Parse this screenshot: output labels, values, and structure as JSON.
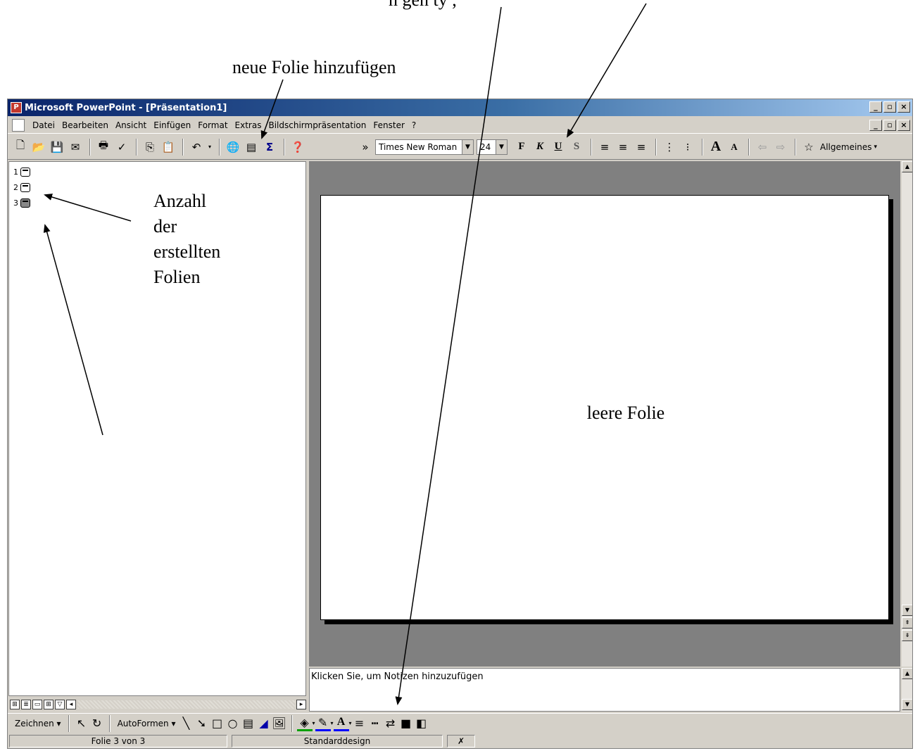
{
  "annotations": {
    "top_text": "n gen ty ,",
    "new_slide": "neue Folie hinzufügen",
    "slide_count": [
      "Anzahl",
      "der",
      "erstellten",
      "Folien"
    ],
    "empty_slide": "leere Folie"
  },
  "window": {
    "title": "Microsoft PowerPoint - [Präsentation1]",
    "min": "_",
    "max": "▫",
    "close": "×"
  },
  "menu": {
    "items": [
      "Datei",
      "Bearbeiten",
      "Ansicht",
      "Einfügen",
      "Format",
      "Extras",
      "Bildschirmpräsentation",
      "Fenster",
      "?"
    ]
  },
  "toolbar": {
    "font_name": "Times New Roman",
    "font_size": "24",
    "bold": "F",
    "italic": "K",
    "underline": "U",
    "shadow": "S",
    "design_label": "Allgemeines",
    "overflow": "»"
  },
  "outline": {
    "slides": [
      "1",
      "2",
      "3"
    ]
  },
  "notes": {
    "placeholder": "Klicken Sie, um Notizen hinzuzufügen"
  },
  "drawbar": {
    "draw": "Zeichnen",
    "autoshapes": "AutoFormen"
  },
  "status": {
    "slide": "Folie 3 von 3",
    "design": "Standarddesign"
  },
  "colors": {
    "title_start": "#0a246a",
    "title_end": "#a6caf0",
    "chrome": "#d4d0c8",
    "slide_bg": "#808080"
  }
}
